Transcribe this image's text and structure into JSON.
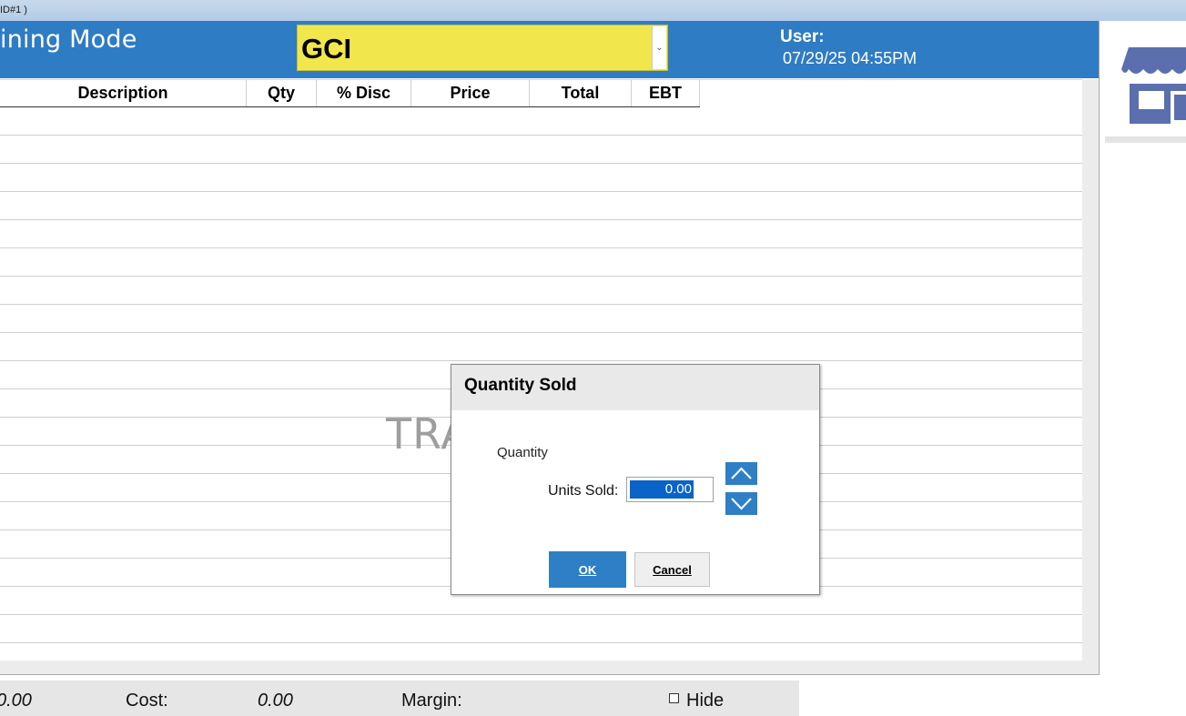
{
  "window": {
    "title_fragment": "ID#1 )"
  },
  "header": {
    "mode_text": "ining Mode",
    "department": {
      "selected": "GCI"
    },
    "user_label": "User:",
    "datetime": "07/29/25 04:55PM"
  },
  "grid": {
    "columns": [
      "Description",
      "Qty",
      "% Disc",
      "Price",
      "Total",
      "EBT"
    ],
    "rows": [],
    "watermark": "TRA"
  },
  "footer": {
    "total_value": "0.00",
    "cost_label": "Cost:",
    "cost_value": "0.00",
    "margin_label": "Margin:",
    "hide_label": "Hide",
    "hide_checked": false
  },
  "dialog": {
    "title": "Quantity Sold",
    "group_label": "Quantity",
    "units_label": "Units Sold:",
    "units_value": "0.00",
    "ok_label": "OK",
    "cancel_label": "Cancel"
  },
  "icons": {
    "store": "store-icon",
    "increment": "chevron-up-icon",
    "decrement": "chevron-down-icon",
    "dropdown": "chevron-down-icon"
  },
  "colors": {
    "header_bg": "#2e7cc3",
    "department_bg": "#f1e64c",
    "accent_button": "#2f7fc6",
    "selection": "#0a63c9",
    "store_icon": "#5b6fae"
  }
}
